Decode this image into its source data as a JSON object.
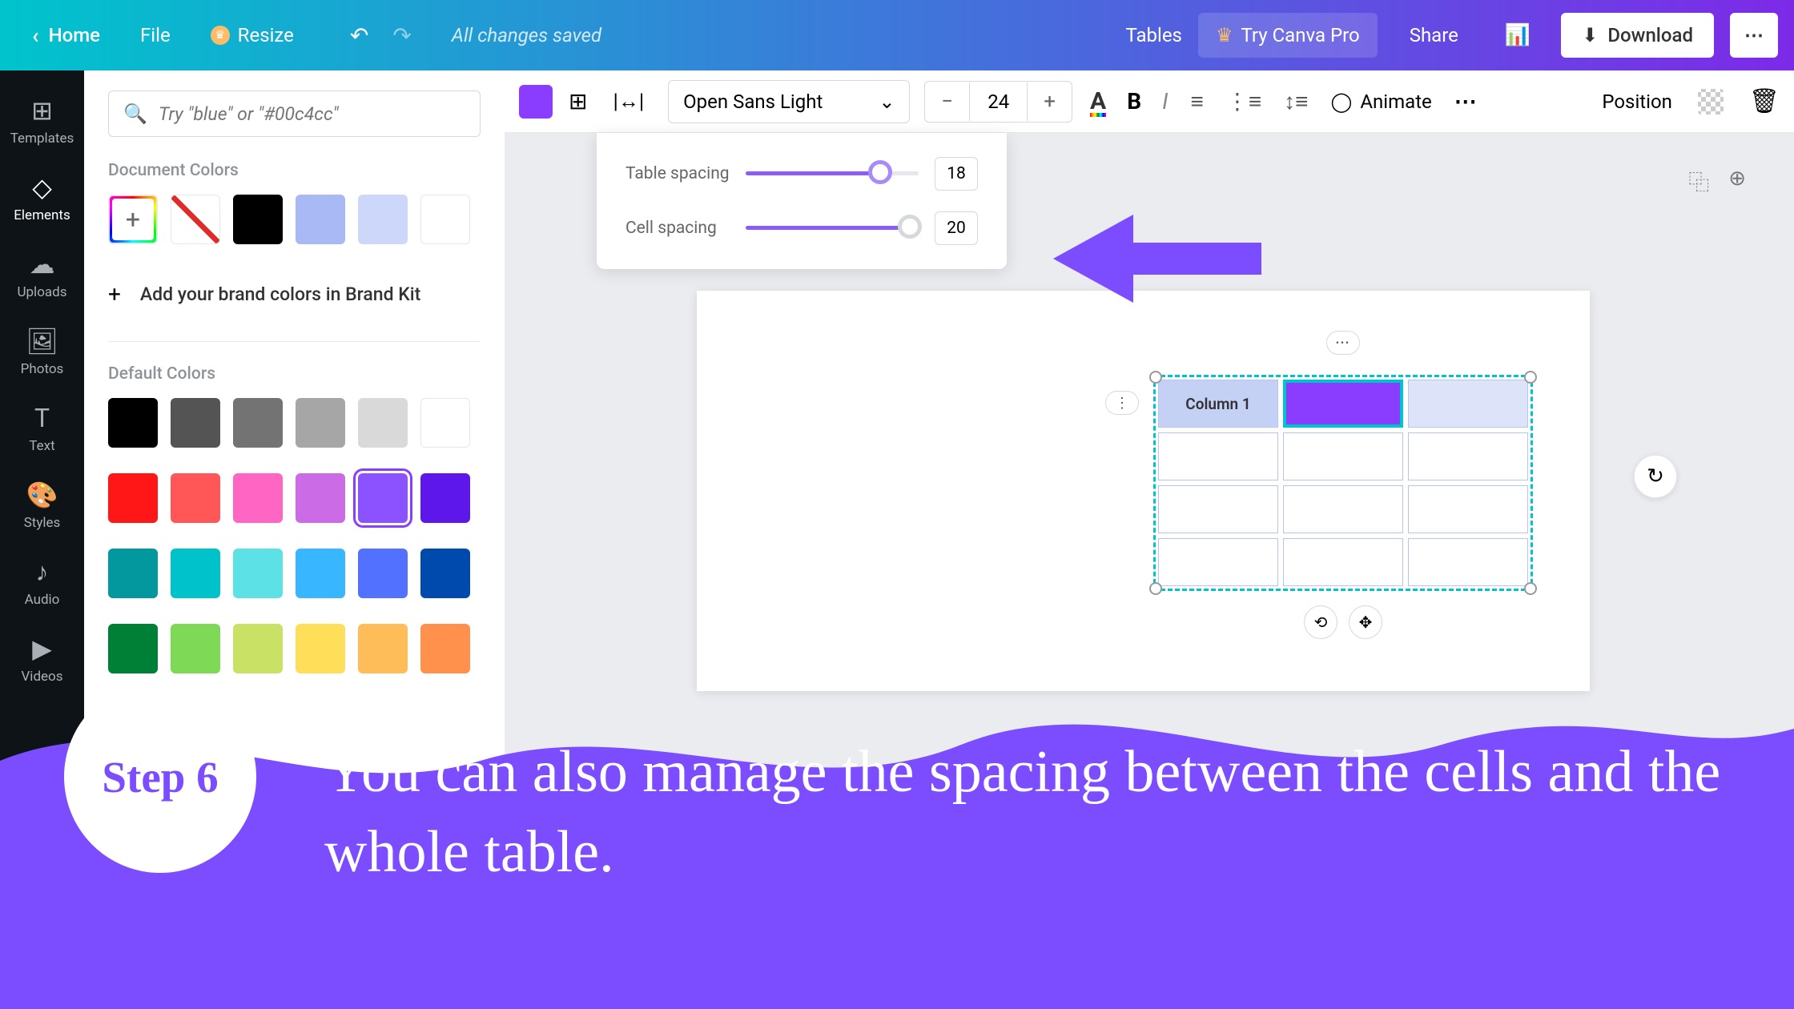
{
  "header": {
    "home": "Home",
    "file": "File",
    "resize": "Resize",
    "saved": "All changes saved",
    "tables": "Tables",
    "try_pro": "Try Canva Pro",
    "share": "Share",
    "download": "Download"
  },
  "sidenav": {
    "templates": "Templates",
    "elements": "Elements",
    "uploads": "Uploads",
    "photos": "Photos",
    "text": "Text",
    "styles": "Styles",
    "audio": "Audio",
    "videos": "Videos"
  },
  "color_panel": {
    "search_placeholder": "Try \"blue\" or \"#00c4cc\"",
    "document_colors": "Document Colors",
    "brand_kit": "Add your brand colors in Brand Kit",
    "default_colors": "Default Colors",
    "doc_colors": [
      "#000000",
      "#a8b9f5",
      "#cdd7f9",
      "#ffffff"
    ],
    "default_rows": [
      [
        "#000000",
        "#545454",
        "#737373",
        "#a6a6a6",
        "#d9d9d9",
        "#ffffff"
      ],
      [
        "#ff1616",
        "#ff5757",
        "#ff66c4",
        "#cb6ce6",
        "#8c52ff",
        "#5e17eb"
      ],
      [
        "#03989e",
        "#00c2cb",
        "#5ce1e6",
        "#38b6ff",
        "#5271ff",
        "#004aad"
      ],
      [
        "#008037",
        "#7ed957",
        "#c9e265",
        "#ffde59",
        "#ffbd59",
        "#ff914d"
      ]
    ],
    "selected_color": "#8c52ff"
  },
  "toolbar": {
    "font": "Open Sans Light",
    "font_size": "24",
    "animate": "Animate",
    "position": "Position"
  },
  "spacing": {
    "table_spacing_label": "Table spacing",
    "table_spacing_value": "18",
    "table_spacing_percent": 78,
    "cell_spacing_label": "Cell spacing",
    "cell_spacing_value": "20",
    "cell_spacing_percent": 95
  },
  "table": {
    "column1": "Column 1"
  },
  "tutorial": {
    "step": "Step 6",
    "text": "You can also manage the spacing between the cells and the whole table."
  }
}
